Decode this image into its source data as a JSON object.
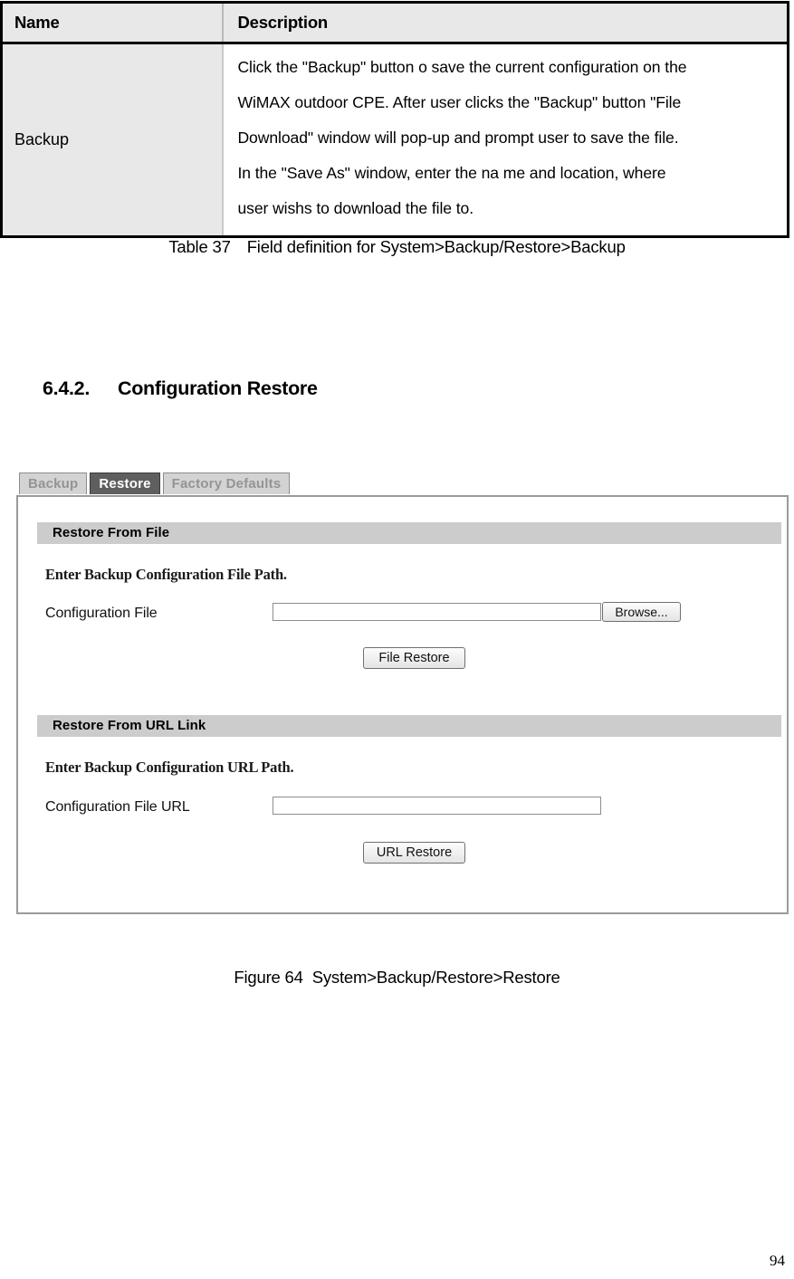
{
  "table": {
    "headers": [
      "Name",
      "Description"
    ],
    "rows": [
      {
        "name": "Backup",
        "description_lines": [
          "Click the \"Backup\" button o save the current configuration on the",
          "WiMAX outdoor CPE. After user clicks the \"Backup\" button \"File",
          "Download\" window will pop-up and prompt user to save the file.",
          "In the \"Save  As\" window, enter the na me and location, where",
          "user wishs to download the file to."
        ]
      }
    ],
    "caption_label": "Table 37",
    "caption_text": "Field definition for System>Backup/Restore>Backup"
  },
  "heading": {
    "number": "6.4.2.",
    "title": "Configuration Restore"
  },
  "ui": {
    "tabs": [
      {
        "label": "Backup",
        "active": false
      },
      {
        "label": "Restore",
        "active": true
      },
      {
        "label": "Factory Defaults",
        "active": false
      }
    ],
    "section_file": {
      "title": "Restore From File",
      "hint": "Enter Backup Configuration File Path.",
      "field_label": "Configuration File",
      "field_value": "",
      "browse_button": "Browse...",
      "submit_button": "File Restore"
    },
    "section_url": {
      "title": "Restore From URL Link",
      "hint": "Enter Backup Configuration URL Path.",
      "field_label": "Configuration File URL",
      "field_value": "",
      "submit_button": "URL Restore"
    },
    "colors": {
      "tab_active_bg": "#5f5f5f",
      "tab_inactive_bg": "#d3d3d3",
      "tab_inactive_text": "#949494",
      "section_bar_bg": "#cccccc",
      "panel_border": "#9a9a9a"
    }
  },
  "figure": {
    "caption_label": "Figure 64",
    "caption_text": "System>Backup/Restore>Restore"
  },
  "page_number": "94"
}
